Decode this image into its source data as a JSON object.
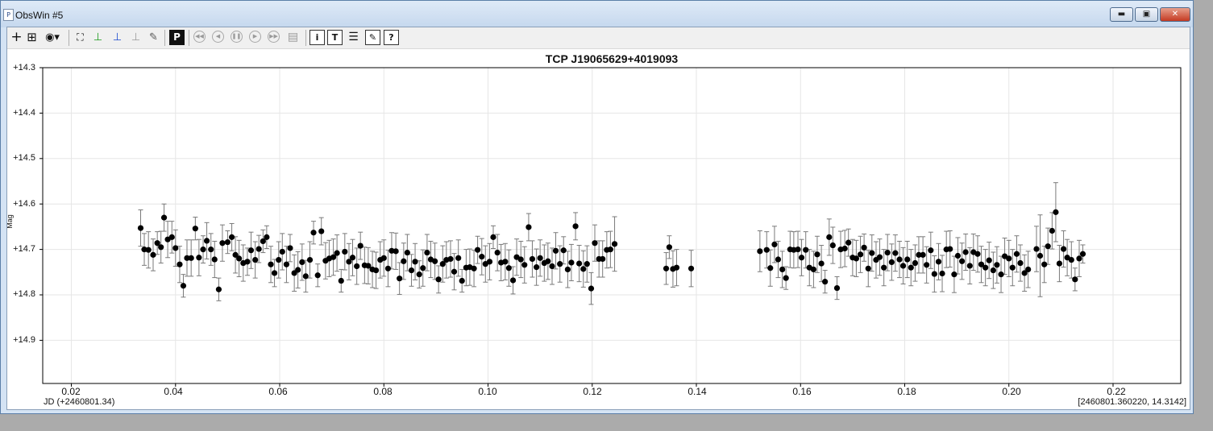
{
  "window": {
    "title": "ObsWin #5",
    "app_icon": "P",
    "controls": [
      "minimize-icon",
      "maximize-icon",
      "close-icon"
    ]
  },
  "toolbar": {
    "icons": [
      "crosshair-plus-icon",
      "crosshair-box-icon",
      "network-dropdown-icon",
      "fit-view-icon",
      "axis-x-green-icon",
      "axis-y-blue-icon",
      "axis-flat-icon",
      "pencil-erase-icon",
      "period-p-icon",
      "rewind-icon",
      "prev-icon",
      "pause-icon",
      "play-icon",
      "fast-forward-icon",
      "notes-icon",
      "info-icon",
      "text-t-icon",
      "list-icon",
      "edit-icon",
      "help-icon"
    ],
    "period_label": "P",
    "info_label": "i",
    "text_label": "T",
    "help_label": "?"
  },
  "chart_data": {
    "type": "scatter",
    "title": "TCP J19065629+4019093",
    "xlabel": "JD (+2460801.34)",
    "ylabel": "Mag",
    "xlim": [
      0.0145,
      0.233
    ],
    "ylim": [
      14.3,
      14.995
    ],
    "y_inverted": true,
    "grid": true,
    "xticks": [
      "0.02",
      "0.04",
      "0.06",
      "0.08",
      "0.10",
      "0.12",
      "0.14",
      "0.16",
      "0.18",
      "0.20",
      "0.22"
    ],
    "yticks": [
      "+14.3",
      "+14.4",
      "+14.5",
      "+14.6",
      "+14.7",
      "+14.8",
      "+14.9"
    ],
    "cursor_readout": "[2460801.360220, 14.3142]",
    "marker_color": "#000000",
    "errorbar_color": "#7a7a7a",
    "grid_color": "#e6e6e6",
    "series": [
      {
        "points": [
          [
            0.0333,
            14.653
          ],
          [
            0.034,
            14.7
          ],
          [
            0.0348,
            14.701
          ],
          [
            0.0357,
            14.712
          ],
          [
            0.0365,
            14.686
          ],
          [
            0.0372,
            14.695
          ],
          [
            0.0378,
            14.63
          ],
          [
            0.0385,
            14.678
          ],
          [
            0.0393,
            14.673
          ],
          [
            0.04,
            14.697
          ],
          [
            0.0408,
            14.733
          ],
          [
            0.0415,
            14.78
          ],
          [
            0.0422,
            14.719
          ],
          [
            0.043,
            14.719
          ],
          [
            0.0438,
            14.654
          ],
          [
            0.0445,
            14.718
          ],
          [
            0.0453,
            14.7
          ],
          [
            0.046,
            14.681
          ],
          [
            0.0468,
            14.7
          ],
          [
            0.0475,
            14.722
          ],
          [
            0.0483,
            14.788
          ],
          [
            0.049,
            14.686
          ],
          [
            0.05,
            14.684
          ],
          [
            0.0508,
            14.673
          ],
          [
            0.0515,
            14.712
          ],
          [
            0.0522,
            14.72
          ],
          [
            0.053,
            14.73
          ],
          [
            0.0538,
            14.727
          ],
          [
            0.0545,
            14.702
          ],
          [
            0.0553,
            14.723
          ],
          [
            0.056,
            14.699
          ],
          [
            0.0568,
            14.682
          ],
          [
            0.0575,
            14.673
          ],
          [
            0.0583,
            14.733
          ],
          [
            0.059,
            14.752
          ],
          [
            0.0598,
            14.723
          ],
          [
            0.0605,
            14.705
          ],
          [
            0.0613,
            14.733
          ],
          [
            0.062,
            14.697
          ],
          [
            0.0628,
            14.752
          ],
          [
            0.0635,
            14.745
          ],
          [
            0.0643,
            14.728
          ],
          [
            0.065,
            14.759
          ],
          [
            0.0658,
            14.723
          ],
          [
            0.0665,
            14.663
          ],
          [
            0.0673,
            14.757
          ],
          [
            0.068,
            14.66
          ],
          [
            0.0688,
            14.725
          ],
          [
            0.0695,
            14.72
          ],
          [
            0.0703,
            14.717
          ],
          [
            0.071,
            14.708
          ],
          [
            0.0718,
            14.769
          ],
          [
            0.0725,
            14.705
          ],
          [
            0.0733,
            14.727
          ],
          [
            0.074,
            14.718
          ],
          [
            0.0748,
            14.737
          ],
          [
            0.0755,
            14.692
          ],
          [
            0.0763,
            14.735
          ],
          [
            0.077,
            14.736
          ],
          [
            0.0778,
            14.744
          ],
          [
            0.0785,
            14.746
          ],
          [
            0.0793,
            14.723
          ],
          [
            0.08,
            14.719
          ],
          [
            0.0808,
            14.742
          ],
          [
            0.0815,
            14.703
          ],
          [
            0.0823,
            14.704
          ],
          [
            0.083,
            14.764
          ],
          [
            0.0838,
            14.726
          ],
          [
            0.0845,
            14.707
          ],
          [
            0.0853,
            14.746
          ],
          [
            0.086,
            14.727
          ],
          [
            0.0868,
            14.755
          ],
          [
            0.0875,
            14.741
          ],
          [
            0.0883,
            14.707
          ],
          [
            0.089,
            14.722
          ],
          [
            0.0898,
            14.726
          ],
          [
            0.0905,
            14.766
          ],
          [
            0.0913,
            14.732
          ],
          [
            0.092,
            14.723
          ],
          [
            0.0928,
            14.721
          ],
          [
            0.0935,
            14.749
          ],
          [
            0.0943,
            14.719
          ],
          [
            0.095,
            14.769
          ],
          [
            0.0958,
            14.74
          ],
          [
            0.0965,
            14.739
          ],
          [
            0.0973,
            14.742
          ],
          [
            0.098,
            14.701
          ],
          [
            0.0988,
            14.716
          ],
          [
            0.0995,
            14.732
          ],
          [
            0.1003,
            14.727
          ],
          [
            0.101,
            14.673
          ],
          [
            0.1018,
            14.707
          ],
          [
            0.1025,
            14.729
          ],
          [
            0.1033,
            14.727
          ],
          [
            0.104,
            14.741
          ],
          [
            0.1048,
            14.768
          ],
          [
            0.1055,
            14.717
          ],
          [
            0.1063,
            14.722
          ],
          [
            0.107,
            14.734
          ],
          [
            0.1078,
            14.651
          ],
          [
            0.1085,
            14.721
          ],
          [
            0.1093,
            14.739
          ],
          [
            0.11,
            14.719
          ],
          [
            0.1108,
            14.73
          ],
          [
            0.1115,
            14.726
          ],
          [
            0.1123,
            14.737
          ],
          [
            0.113,
            14.703
          ],
          [
            0.1138,
            14.732
          ],
          [
            0.1145,
            14.702
          ],
          [
            0.1153,
            14.744
          ],
          [
            0.116,
            14.729
          ],
          [
            0.1168,
            14.649
          ],
          [
            0.1175,
            14.731
          ],
          [
            0.1183,
            14.743
          ],
          [
            0.119,
            14.732
          ],
          [
            0.1198,
            14.786
          ],
          [
            0.1205,
            14.686
          ],
          [
            0.1213,
            14.721
          ],
          [
            0.122,
            14.721
          ],
          [
            0.1228,
            14.701
          ],
          [
            0.1235,
            14.7
          ],
          [
            0.1243,
            14.688
          ],
          [
            0.1342,
            14.742
          ],
          [
            0.1348,
            14.695
          ],
          [
            0.1355,
            14.743
          ],
          [
            0.1362,
            14.74
          ],
          [
            0.139,
            14.742
          ],
          [
            0.1522,
            14.704
          ],
          [
            0.1535,
            14.701
          ],
          [
            0.1542,
            14.741
          ],
          [
            0.155,
            14.689
          ],
          [
            0.1557,
            14.722
          ],
          [
            0.1565,
            14.744
          ],
          [
            0.1572,
            14.763
          ],
          [
            0.158,
            14.7
          ],
          [
            0.1587,
            14.701
          ],
          [
            0.1595,
            14.7
          ],
          [
            0.1602,
            14.718
          ],
          [
            0.161,
            14.701
          ],
          [
            0.1617,
            14.74
          ],
          [
            0.1625,
            14.744
          ],
          [
            0.1632,
            14.711
          ],
          [
            0.164,
            14.731
          ],
          [
            0.1647,
            14.771
          ],
          [
            0.1655,
            14.673
          ],
          [
            0.1662,
            14.691
          ],
          [
            0.167,
            14.785
          ],
          [
            0.1677,
            14.7
          ],
          [
            0.1685,
            14.698
          ],
          [
            0.1692,
            14.685
          ],
          [
            0.17,
            14.718
          ],
          [
            0.1707,
            14.72
          ],
          [
            0.1715,
            14.711
          ],
          [
            0.1722,
            14.696
          ],
          [
            0.173,
            14.742
          ],
          [
            0.1737,
            14.708
          ],
          [
            0.1745,
            14.723
          ],
          [
            0.1752,
            14.717
          ],
          [
            0.176,
            14.74
          ],
          [
            0.1767,
            14.707
          ],
          [
            0.1775,
            14.728
          ],
          [
            0.1782,
            14.708
          ],
          [
            0.179,
            14.722
          ],
          [
            0.1797,
            14.736
          ],
          [
            0.1805,
            14.722
          ],
          [
            0.1812,
            14.74
          ],
          [
            0.182,
            14.73
          ],
          [
            0.1827,
            14.712
          ],
          [
            0.1835,
            14.712
          ],
          [
            0.1842,
            14.734
          ],
          [
            0.185,
            14.702
          ],
          [
            0.1857,
            14.754
          ],
          [
            0.1865,
            14.727
          ],
          [
            0.1872,
            14.753
          ],
          [
            0.188,
            14.7
          ],
          [
            0.1887,
            14.699
          ],
          [
            0.1895,
            14.755
          ],
          [
            0.1902,
            14.714
          ],
          [
            0.191,
            14.726
          ],
          [
            0.1917,
            14.706
          ],
          [
            0.1925,
            14.736
          ],
          [
            0.1932,
            14.706
          ],
          [
            0.194,
            14.71
          ],
          [
            0.1947,
            14.733
          ],
          [
            0.1955,
            14.74
          ],
          [
            0.1962,
            14.724
          ],
          [
            0.197,
            14.746
          ],
          [
            0.1977,
            14.734
          ],
          [
            0.1985,
            14.755
          ],
          [
            0.1992,
            14.715
          ],
          [
            0.2,
            14.72
          ],
          [
            0.2007,
            14.74
          ],
          [
            0.2015,
            14.71
          ],
          [
            0.2022,
            14.73
          ],
          [
            0.203,
            14.752
          ],
          [
            0.2037,
            14.744
          ],
          [
            0.2053,
            14.699
          ],
          [
            0.206,
            14.714
          ],
          [
            0.2068,
            14.733
          ],
          [
            0.2075,
            14.693
          ],
          [
            0.2083,
            14.659
          ],
          [
            0.209,
            14.618
          ],
          [
            0.2097,
            14.731
          ],
          [
            0.2105,
            14.699
          ],
          [
            0.2112,
            14.718
          ],
          [
            0.212,
            14.723
          ],
          [
            0.2127,
            14.766
          ],
          [
            0.2135,
            14.72
          ],
          [
            0.2142,
            14.71
          ]
        ],
        "errors": [
          0.04,
          0.035,
          0.04,
          0.035,
          0.025,
          0.035,
          0.03,
          0.04,
          0.035,
          0.04,
          0.04,
          0.025,
          0.04,
          0.04,
          0.025,
          0.04,
          0.03,
          0.04,
          0.035,
          0.04,
          0.025,
          0.04,
          0.025,
          0.03,
          0.04,
          0.04,
          0.04,
          0.03,
          0.04,
          0.04,
          0.03,
          0.025,
          0.025,
          0.04,
          0.03,
          0.04,
          0.04,
          0.04,
          0.03,
          0.04,
          0.04,
          0.04,
          0.035,
          0.04,
          0.025,
          0.025,
          0.03,
          0.04,
          0.04,
          0.04,
          0.04,
          0.025,
          0.04,
          0.04,
          0.04,
          0.04,
          0.03,
          0.04,
          0.04,
          0.04,
          0.04,
          0.04,
          0.04,
          0.04,
          0.04,
          0.04,
          0.035,
          0.04,
          0.04,
          0.035,
          0.04,
          0.03,
          0.04,
          0.04,
          0.04,
          0.04,
          0.03,
          0.04,
          0.04,
          0.04,
          0.04,
          0.04,
          0.025,
          0.04,
          0.04,
          0.04,
          0.03,
          0.04,
          0.04,
          0.04,
          0.025,
          0.04,
          0.04,
          0.04,
          0.04,
          0.03,
          0.04,
          0.04,
          0.04,
          0.03,
          0.04,
          0.04,
          0.04,
          0.04,
          0.04,
          0.04,
          0.04,
          0.04,
          0.03,
          0.04,
          0.04,
          0.03,
          0.04,
          0.04,
          0.04,
          0.035,
          0.04,
          0.04,
          0.04,
          0.04,
          0.04,
          0.06,
          0.035,
          0.025,
          0.04,
          0.04,
          0.04,
          0.045,
          0.04,
          0.04,
          0.04,
          0.04,
          0.04,
          0.025,
          0.04,
          0.04,
          0.04,
          0.04,
          0.04,
          0.04,
          0.04,
          0.04,
          0.04,
          0.025,
          0.04,
          0.04,
          0.025,
          0.04,
          0.04,
          0.03,
          0.04,
          0.04,
          0.04,
          0.03,
          0.04,
          0.04,
          0.04,
          0.04,
          0.04,
          0.04,
          0.04,
          0.04,
          0.04,
          0.04,
          0.04,
          0.04,
          0.04,
          0.04,
          0.04,
          0.04,
          0.04,
          0.04,
          0.04,
          0.04,
          0.04,
          0.04,
          0.04,
          0.04,
          0.04,
          0.04,
          0.04,
          0.04,
          0.04,
          0.04,
          0.04,
          0.04,
          0.04,
          0.04,
          0.04,
          0.04,
          0.04,
          0.04,
          0.04,
          0.04,
          0.04,
          0.04,
          0.05,
          0.09,
          0.04,
          0.04,
          0.04,
          0.065,
          0.04,
          0.04,
          0.04,
          0.04,
          0.025,
          0.04,
          0.02
        ]
      }
    ]
  }
}
